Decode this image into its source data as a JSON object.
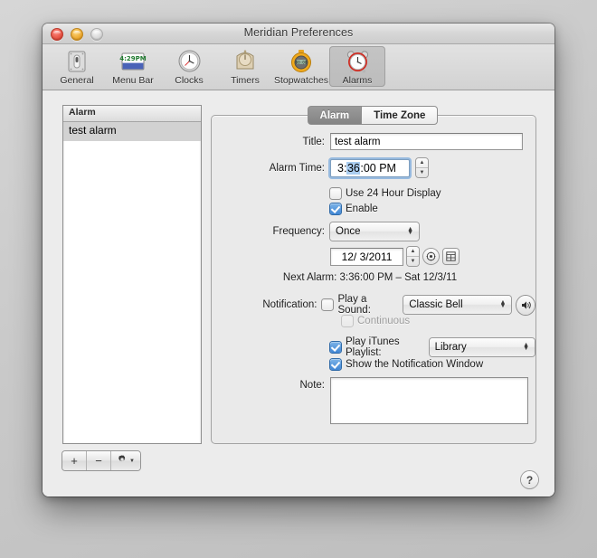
{
  "window": {
    "title": "Meridian Preferences",
    "traffic_lights": [
      "close",
      "minimize",
      "zoom"
    ]
  },
  "toolbar": {
    "items": [
      {
        "label": "General",
        "icon": "switch-icon",
        "selected": false
      },
      {
        "label": "Menu Bar",
        "icon": "menubar-clock-icon",
        "selected": false,
        "clock_text": "4:29 PM"
      },
      {
        "label": "Clocks",
        "icon": "clock-icon",
        "selected": false
      },
      {
        "label": "Timers",
        "icon": "timer-icon",
        "selected": false
      },
      {
        "label": "Stopwatches",
        "icon": "stopwatch-icon",
        "selected": false
      },
      {
        "label": "Alarms",
        "icon": "alarm-clock-icon",
        "selected": true
      }
    ]
  },
  "sidebar": {
    "header": "Alarm",
    "rows": [
      {
        "name": "test alarm",
        "selected": true
      }
    ],
    "buttons": {
      "add": "+",
      "remove": "−",
      "action": "gear"
    }
  },
  "tabs": [
    {
      "label": "Alarm",
      "active": true
    },
    {
      "label": "Time Zone",
      "active": false
    }
  ],
  "form": {
    "title_label": "Title:",
    "title_value": "test alarm",
    "alarm_time_label": "Alarm Time:",
    "alarm_time": {
      "hour": "3",
      "sep1": ":",
      "minute": "36",
      "sep2": ":",
      "second": "00",
      "meridiem": " PM",
      "selected_field": "minute"
    },
    "use_24h": {
      "label": "Use 24 Hour Display",
      "checked": false
    },
    "enable": {
      "label": "Enable",
      "checked": true
    },
    "frequency_label": "Frequency:",
    "frequency_value": "Once",
    "date_value": "12/ 3/2011",
    "next_alarm": "Next Alarm: 3:36:00 PM  – Sat 12/3/11",
    "notification_label": "Notification:",
    "play_sound": {
      "label": "Play a Sound:",
      "checked": false
    },
    "sound_value": "Classic Bell",
    "continuous": {
      "label": "Continuous",
      "checked": false,
      "disabled": true
    },
    "play_itunes": {
      "label": "Play iTunes Playlist:",
      "checked": true
    },
    "playlist_value": "Library",
    "show_notification": {
      "label": "Show the Notification Window",
      "checked": true
    },
    "note_label": "Note:",
    "note_value": ""
  },
  "help": {
    "label": "?"
  },
  "colors": {
    "accent": "#3f85d4",
    "selection": "#aacdf0",
    "window_bg": "#ececec",
    "pane_bg": "#eaeaea"
  }
}
